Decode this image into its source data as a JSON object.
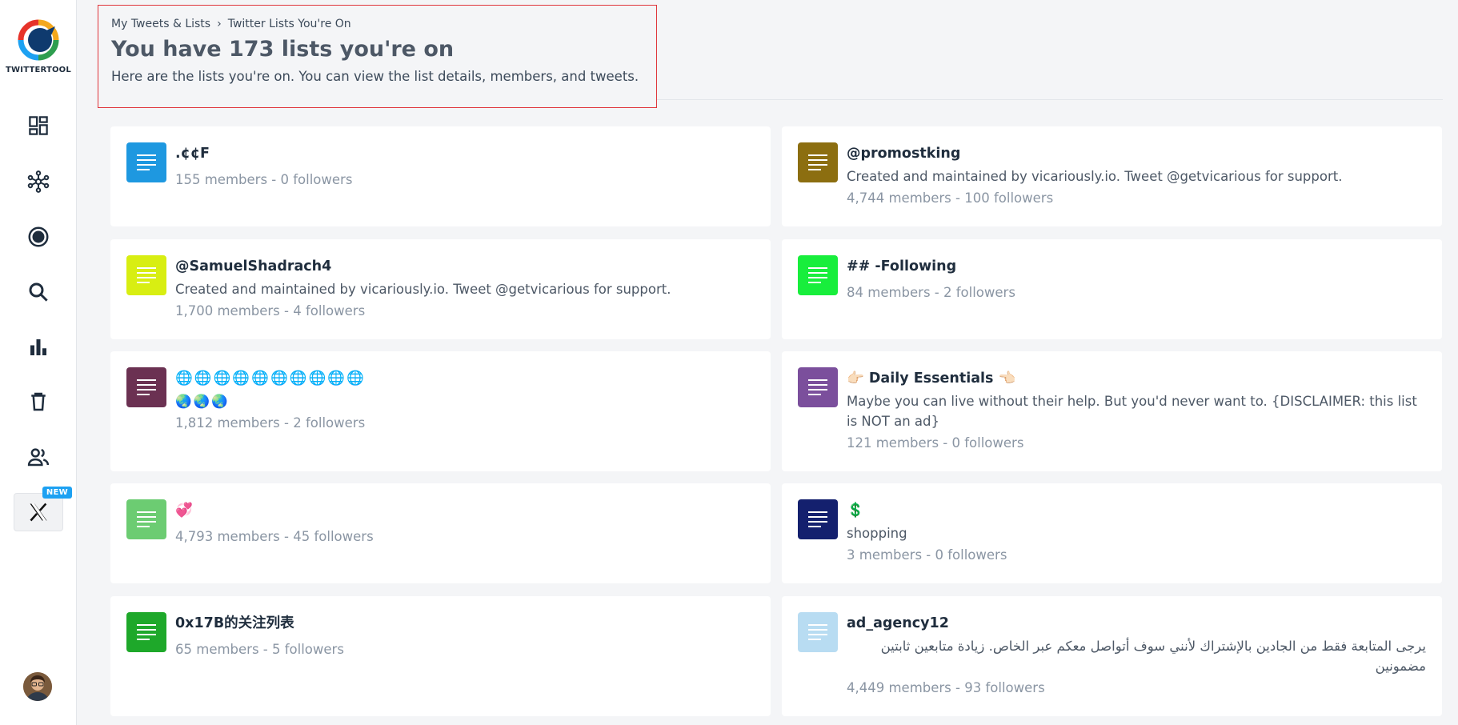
{
  "brand": {
    "name": "TWITTERTOOL"
  },
  "nav": [
    {
      "name": "dashboard",
      "icon": "dashboard-icon"
    },
    {
      "name": "network",
      "icon": "network-icon"
    },
    {
      "name": "target",
      "icon": "target-icon"
    },
    {
      "name": "search",
      "icon": "search-icon"
    },
    {
      "name": "analytics",
      "icon": "bar-chart-icon"
    },
    {
      "name": "delete",
      "icon": "trash-icon"
    },
    {
      "name": "users",
      "icon": "users-icon"
    },
    {
      "name": "x",
      "icon": "x-logo-icon",
      "badge": "NEW"
    }
  ],
  "breadcrumb": {
    "parent": "My Tweets & Lists",
    "current": "Twitter Lists You're On"
  },
  "header": {
    "title": "You have 173 lists you're on",
    "subtitle": "Here are the lists you're on. You can view the list details, members, and tweets."
  },
  "lists": [
    {
      "name": ".¢¢F",
      "description": "",
      "meta": "155 members - 0 followers",
      "color": "#1e98e0"
    },
    {
      "name": "@promostking",
      "description": "Created and maintained by vicariously.io. Tweet @getvicarious for support.",
      "meta": "4,744 members - 100 followers",
      "color": "#8c6e10"
    },
    {
      "name": "@SamuelShadrach4",
      "description": "Created and maintained by vicariously.io. Tweet @getvicarious for support.",
      "meta": "1,700 members - 4 followers",
      "color": "#d8ee12"
    },
    {
      "name": "## -Following",
      "description": "",
      "meta": "84 members - 2 followers",
      "color": "#18ee3c"
    },
    {
      "name": "🌐🌐🌐🌐🌐🌐🌐🌐🌐🌐",
      "description": "🌏🌏🌏",
      "meta": "1,812 members - 2 followers",
      "color": "#6b3152"
    },
    {
      "name": "👉🏻 Daily Essentials 👈🏻",
      "description": "Maybe you can live without their help. But you'd never want to. {DISCLAIMER: this list is NOT an ad}",
      "meta": "121 members - 0 followers",
      "color": "#7b4f9c"
    },
    {
      "name": "💞",
      "description": "",
      "meta": "4,793 members - 45 followers",
      "color": "#6ccc72"
    },
    {
      "name": "💲",
      "description": "shopping",
      "meta": "3 members - 0 followers",
      "color": "#14206e"
    },
    {
      "name": "0x17B的关注列表",
      "description": "",
      "meta": "65 members - 5 followers",
      "color": "#1ea82a"
    },
    {
      "name": "ad_agency12",
      "description": "يرجى المتابعة فقط من الجادين بالإشتراك لأنني سوف أتواصل معكم عبر الخاص. زيادة متابعين ثابتين مضمونين",
      "meta": "4,449 members - 93 followers",
      "color": "#b8dcf2"
    }
  ]
}
